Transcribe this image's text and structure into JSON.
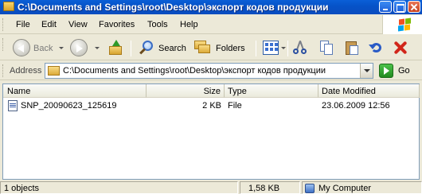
{
  "window": {
    "title": "C:\\Documents and Settings\\root\\Desktop\\экспорт кодов продукции"
  },
  "menu": [
    "File",
    "Edit",
    "View",
    "Favorites",
    "Tools",
    "Help"
  ],
  "toolbar": {
    "back_label": "Back",
    "search_label": "Search",
    "folders_label": "Folders"
  },
  "address": {
    "label": "Address",
    "value": "C:\\Documents and Settings\\root\\Desktop\\экспорт кодов продукции",
    "go_label": "Go"
  },
  "filelist": {
    "columns": [
      "Name",
      "Size",
      "Type",
      "Date Modified"
    ],
    "rows": [
      {
        "name": "SNP_20090623_125619",
        "size": "2 KB",
        "type": "File",
        "date": "23.06.2009 12:56"
      }
    ]
  },
  "status": {
    "objects": "1 objects",
    "size": "1,58 KB",
    "location": "My Computer"
  },
  "colors": {
    "titlebar": "#0a5fd7",
    "chrome": "#ece9d8"
  }
}
